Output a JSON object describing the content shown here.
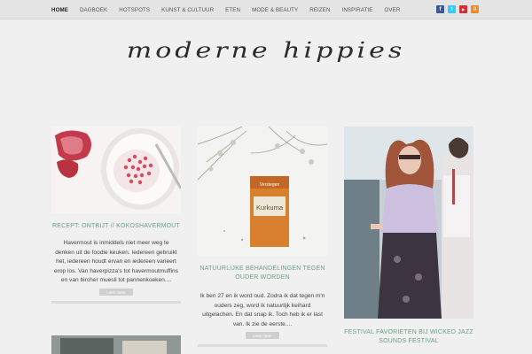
{
  "nav": {
    "items": [
      "HOME",
      "DAGBOEK",
      "HOTSPOTS",
      "KUNST & CULTUUR",
      "ETEN",
      "MODE & BEAUTY",
      "REIZEN",
      "INSPIRATIE",
      "OVER"
    ],
    "active_index": 0
  },
  "social": [
    {
      "name": "facebook",
      "glyph": "f",
      "color": "#3b5998"
    },
    {
      "name": "twitter",
      "glyph": "t",
      "color": "#33ccff"
    },
    {
      "name": "youtube",
      "glyph": "▶",
      "color": "#cc3333"
    },
    {
      "name": "rss",
      "glyph": "))",
      "color": "#f08a24"
    }
  ],
  "logo_text": "moderne hippies",
  "posts": [
    {
      "title": "RECEPT: ONTBIJT // KOKOSHAVERMOUT",
      "excerpt": "Havermout is inmiddels niet meer weg te denken uit de foodie keuken. Iedereen gebruikt het, iedereen houdt ervan en iedereen varieert erop los. Van haverpizza's tot havermoutmuffins en van bircher muesli tot pannenkoeken....",
      "more_label": "Lees meer"
    },
    {
      "title": "NATUURLIJKE BEHANDELINGEN TEGEN OUDER WORDEN",
      "excerpt": "Ik ben 27 en ik word oud. Zodra ik dat tegen m'n ouders zeg, word ik natuurlijk keihard uitgelachen. En dat snap ik. Toch heb ik er last van. Ik zie de eerste....",
      "more_label": "Lees meer",
      "photo_label": "Kurkuma",
      "photo_brand": "Verstegen"
    },
    {
      "title": "FESTIVAL FAVORIETEN BIJ WICKED JAZZ SOUNDS FESTIVAL"
    }
  ]
}
